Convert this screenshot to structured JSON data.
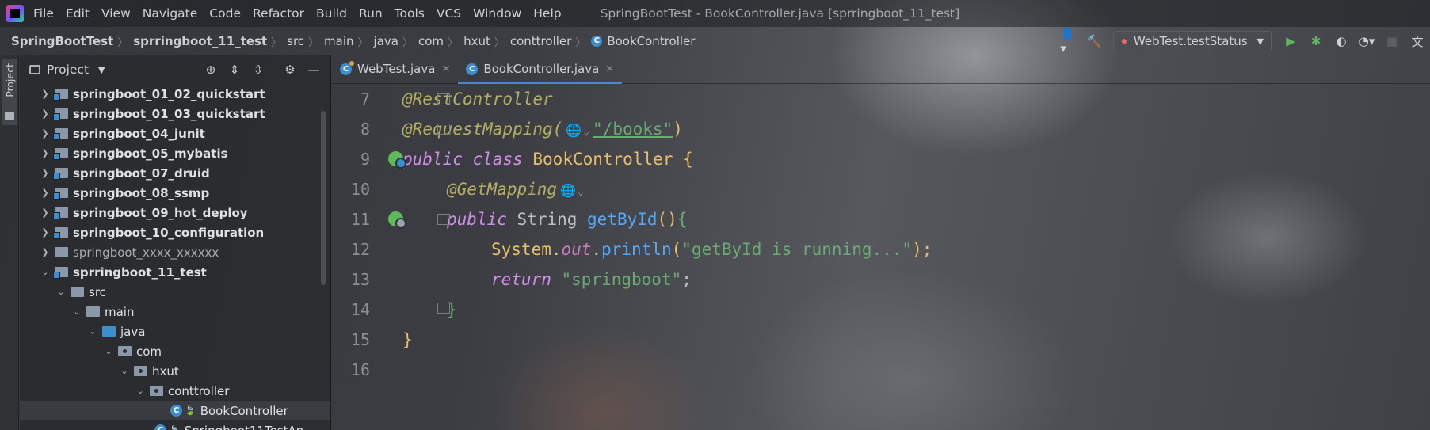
{
  "menubar": {
    "items": [
      "File",
      "Edit",
      "View",
      "Navigate",
      "Code",
      "Refactor",
      "Build",
      "Run",
      "Tools",
      "VCS",
      "Window",
      "Help"
    ],
    "window_title": "SpringBootTest - BookController.java [sprringboot_11_test]"
  },
  "breadcrumb": {
    "items": [
      "SpringBootTest",
      "sprringboot_11_test",
      "src",
      "main",
      "java",
      "com",
      "hxut",
      "conttroller",
      "BookController"
    ]
  },
  "toolbar": {
    "run_config": "WebTest.testStatus"
  },
  "side_strip": {
    "project_tab": "Project"
  },
  "project": {
    "title": "Project",
    "tree": [
      {
        "label": "springboot_01_02_quickstart"
      },
      {
        "label": "springboot_01_03_quickstart"
      },
      {
        "label": "springboot_04_junit"
      },
      {
        "label": "springboot_05_mybatis"
      },
      {
        "label": "springboot_07_druid"
      },
      {
        "label": "springboot_08_ssmp"
      },
      {
        "label": "springboot_09_hot_deploy"
      },
      {
        "label": "springboot_10_configuration"
      },
      {
        "label": "springboot_xxxx_xxxxxx"
      },
      {
        "label": "sprringboot_11_test"
      },
      {
        "label": "src"
      },
      {
        "label": "main"
      },
      {
        "label": "java"
      },
      {
        "label": "com"
      },
      {
        "label": "hxut"
      },
      {
        "label": "conttroller"
      },
      {
        "label": "BookController"
      },
      {
        "label": "Springboot11TestAp"
      }
    ]
  },
  "tabs": [
    {
      "label": "WebTest.java"
    },
    {
      "label": "BookController.java"
    }
  ],
  "editor": {
    "lines": [
      {
        "num": "7"
      },
      {
        "num": "8"
      },
      {
        "num": "9"
      },
      {
        "num": "10"
      },
      {
        "num": "11"
      },
      {
        "num": "12"
      },
      {
        "num": "13"
      },
      {
        "num": "14"
      },
      {
        "num": "15"
      },
      {
        "num": "16"
      }
    ],
    "tokens": {
      "l7_ann": "@RestController",
      "l8_ann": "@RequestMapping(",
      "l8_str": "\"/books\"",
      "l8_close": ")",
      "l9_public": "public",
      "l9_class": "class",
      "l9_name": "BookController",
      "l9_brace": "{",
      "l10_ann": "@GetMapping",
      "l11_public": "public",
      "l11_type": "String",
      "l11_fn": "getById",
      "l11_parens": "()",
      "l11_brace": "{",
      "l12_system": "System.",
      "l12_out": "out",
      "l12_dot": ".",
      "l12_fn": "println",
      "l12_open": "(",
      "l12_str": "\"getById is running...\"",
      "l12_close": ");",
      "l13_return": "return",
      "l13_str": "\"springboot\"",
      "l13_semi": ";",
      "l14_brace": "}",
      "l15_brace": "}"
    }
  }
}
